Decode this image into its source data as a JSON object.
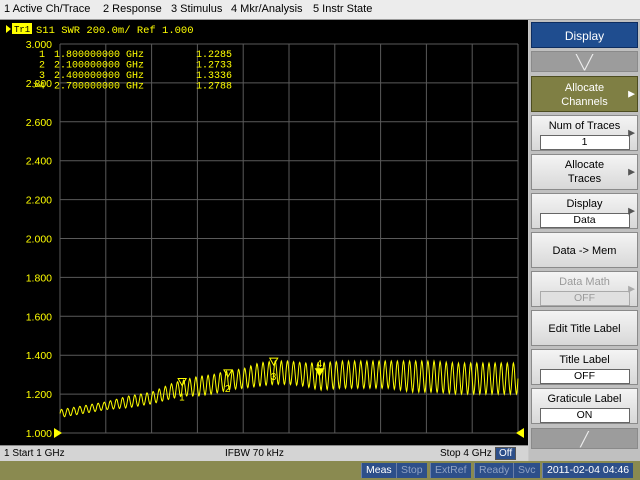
{
  "menu": [
    "1 Active Ch/Trace",
    "2 Response",
    "3 Stimulus",
    "4 Mkr/Analysis",
    "5 Instr State"
  ],
  "trace_header": {
    "badge": "Tr1",
    "text": "S11  SWR  200.0m/ Ref 1.000"
  },
  "markers": [
    {
      "prefix": "1",
      "freq": "1.800000000 GHz",
      "value": "1.2285",
      "label": "1"
    },
    {
      "prefix": "2",
      "freq": "2.100000000 GHz",
      "value": "1.2733",
      "label": "2"
    },
    {
      "prefix": "3",
      "freq": "2.400000000 GHz",
      "value": "1.3336",
      "label": "3"
    },
    {
      "prefix": ">4",
      "freq": "2.700000000 GHz",
      "value": "1.2788",
      "label": "4"
    }
  ],
  "chart_data": {
    "type": "line",
    "trace": "S11",
    "format": "SWR",
    "scale_per_div": "200.0m",
    "reference": "1.000",
    "x_start_ghz": 1,
    "x_stop_ghz": 4,
    "ylim": [
      1.0,
      3.0
    ],
    "y_tick_labels": [
      "3.000",
      "2.800",
      "2.600",
      "2.400",
      "2.200",
      "2.000",
      "1.800",
      "1.600",
      "1.400",
      "1.200",
      "1.000"
    ],
    "x_divisions": 10,
    "series": [
      {
        "color": "#ffff00",
        "x": [
          1.0,
          1.15,
          1.3,
          1.45,
          1.6,
          1.75,
          1.8,
          1.9,
          2.0,
          2.1,
          2.2,
          2.3,
          2.4,
          2.5,
          2.6,
          2.7,
          2.85,
          3.0,
          3.15,
          3.3,
          3.45,
          3.6,
          3.75,
          3.9,
          4.0
        ],
        "center": [
          1.1,
          1.12,
          1.14,
          1.16,
          1.18,
          1.22,
          1.23,
          1.24,
          1.25,
          1.27,
          1.28,
          1.3,
          1.31,
          1.31,
          1.3,
          1.29,
          1.3,
          1.3,
          1.3,
          1.29,
          1.29,
          1.28,
          1.28,
          1.28,
          1.28
        ],
        "ripple": [
          0.02,
          0.02,
          0.02,
          0.03,
          0.03,
          0.04,
          0.04,
          0.05,
          0.05,
          0.05,
          0.05,
          0.06,
          0.06,
          0.06,
          0.06,
          0.07,
          0.07,
          0.07,
          0.07,
          0.08,
          0.08,
          0.08,
          0.08,
          0.08,
          0.08
        ],
        "ripple_cycles": 75
      }
    ],
    "marker_points": [
      {
        "x": 1.8,
        "y": 1.2285
      },
      {
        "x": 2.1,
        "y": 1.2733
      },
      {
        "x": 2.4,
        "y": 1.3336
      },
      {
        "x": 2.7,
        "y": 1.2788
      }
    ],
    "grid": true,
    "colors": {
      "grid": "#5a5a5a",
      "trace": "#ffff00",
      "background": "#000000",
      "ref_marker": "#ffff00"
    }
  },
  "footer": {
    "start": "1  Start 1 GHz",
    "ifbw": "IFBW 70 kHz",
    "stop": "Stop 4 GHz",
    "off": "Off"
  },
  "status": {
    "meas": "Meas",
    "stop": "Stop",
    "extref": "ExtRef",
    "ready": "Ready",
    "svc": "Svc",
    "datetime": "2011-02-04 04:46"
  },
  "softkeys": {
    "title": "Display",
    "scroll_up_icon": "chevron-up",
    "scroll_down_icon": "chevron-down",
    "allocate_channels": "Allocate Channels",
    "num_traces": {
      "label": "Num of Traces",
      "value": "1"
    },
    "allocate_traces": "Allocate Traces",
    "display": {
      "label": "Display",
      "value": "Data"
    },
    "data_mem": "Data -> Mem",
    "data_math": {
      "label": "Data Math",
      "value": "OFF"
    },
    "edit_title": "Edit Title Label",
    "title_label": {
      "label": "Title Label",
      "value": "OFF"
    },
    "graticule_label": {
      "label": "Graticule Label",
      "value": "ON"
    }
  }
}
